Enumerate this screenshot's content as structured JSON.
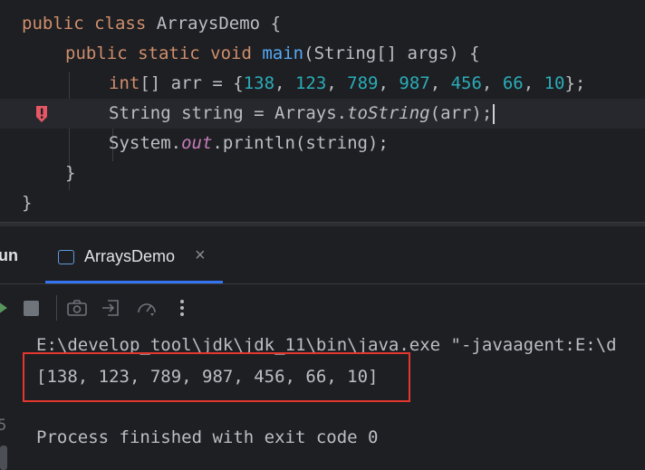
{
  "code": {
    "line1": {
      "kw": "public class",
      "name": "ArraysDemo",
      "brace": "{"
    },
    "line2": {
      "kw": "public static void",
      "method": "main",
      "params": "(String[] args) {"
    },
    "line3": {
      "kw": "int",
      "decl": "[] arr = {",
      "nums": [
        "138",
        "123",
        "789",
        "987",
        "456",
        "66",
        "10"
      ],
      "end": "};"
    },
    "line4": {
      "prefix": "String string = Arrays.",
      "method": "toString",
      "suffix": "(arr);"
    },
    "line5": {
      "prefix": "System.",
      "field": "out",
      "suffix": ".println(string);"
    },
    "line6": "}",
    "line7": "}"
  },
  "toolwindow": {
    "run_label": "un",
    "tab_label": "ArraysDemo",
    "tab_close": "×"
  },
  "console": {
    "line1": "E:\\develop_tool\\jdk\\jdk_11\\bin\\java.exe \"-javaagent:E:\\d",
    "output": "[138, 123, 789, 987, 456, 66, 10]",
    "exit": "Process finished with exit code 0"
  },
  "gutter_digit": "5",
  "colors": {
    "accent": "#3574f0",
    "error": "#e3372f",
    "keyword": "#cf8e6d",
    "number": "#2aacb8",
    "method": "#56a8f5"
  }
}
